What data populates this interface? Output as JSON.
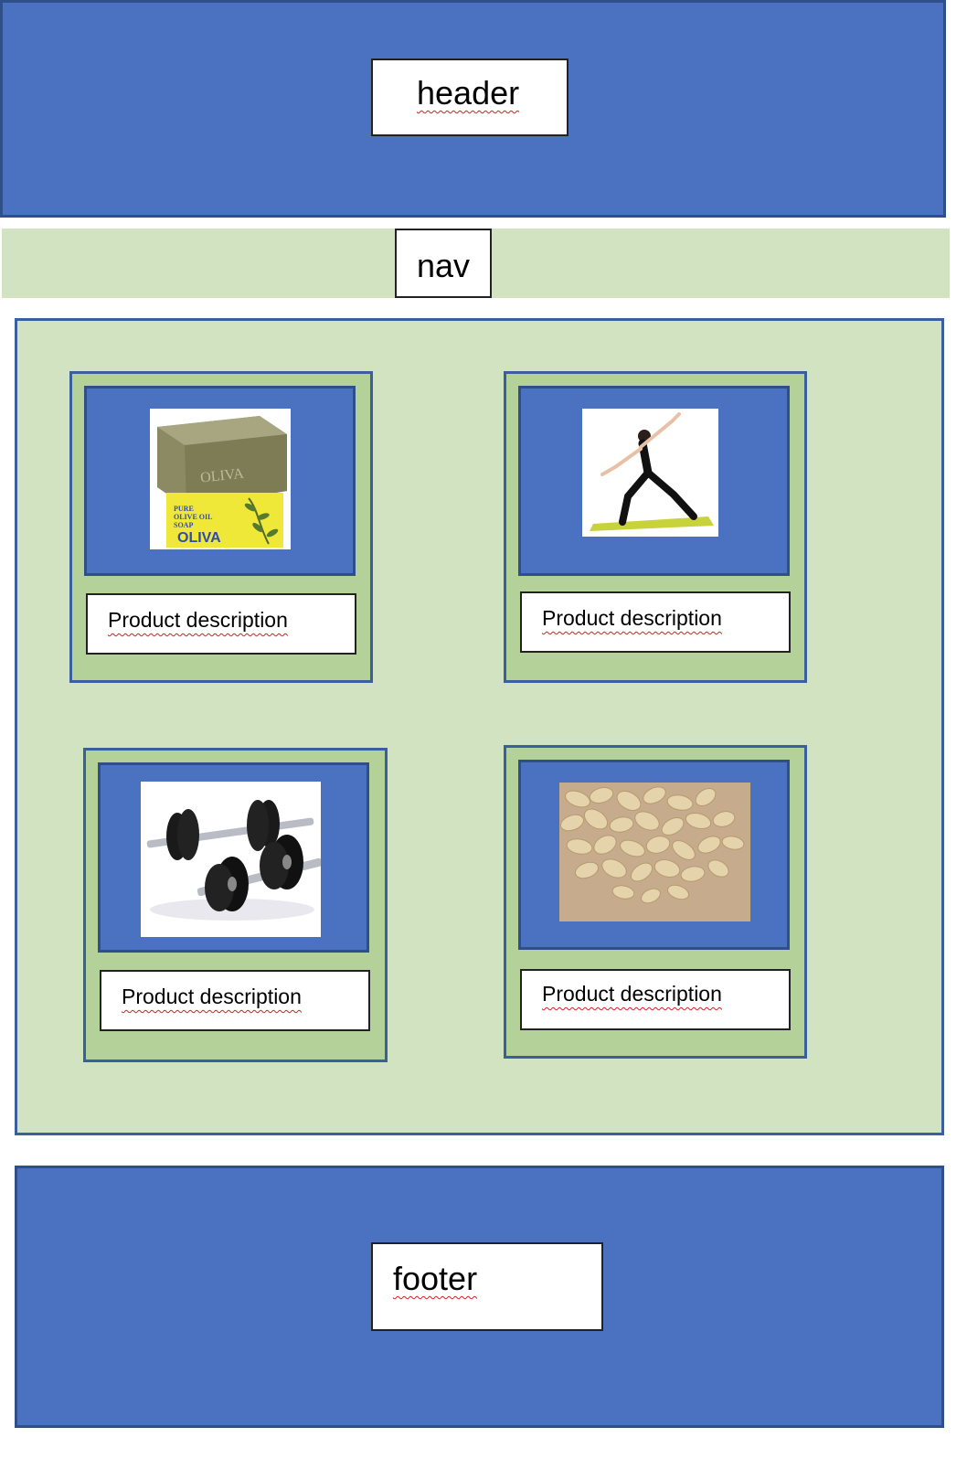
{
  "header": {
    "label": "header"
  },
  "nav": {
    "label": "nav"
  },
  "main": {
    "products": [
      {
        "image": "olive-oil-soap-bar",
        "description": "Product description"
      },
      {
        "image": "yoga-pose-woman-on-mat",
        "description": "Product description"
      },
      {
        "image": "dumbbells",
        "description": "Product description"
      },
      {
        "image": "rolled-oats",
        "description": "Product description"
      }
    ]
  },
  "footer": {
    "label": "footer"
  },
  "colors": {
    "blue": "#4a72c0",
    "light_green": "#d1e3c1",
    "card_green": "#b3d198",
    "border_blue": "#3a5f9e"
  },
  "soap_text": {
    "stamp": "OLIVA",
    "box_lines": [
      "PURE",
      "OLIVE OIL",
      "SOAP"
    ],
    "box_brand": "OLIVA"
  }
}
